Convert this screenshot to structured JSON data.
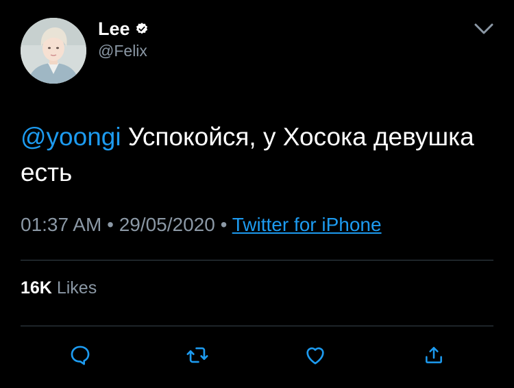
{
  "author": {
    "display_name": "Lee",
    "handle": "@Felix",
    "verified": true
  },
  "tweet": {
    "mention": "@yoongi",
    "body": " Успокойся, у Хосока девушка есть"
  },
  "meta": {
    "time": "01:37 AM",
    "separator": " • ",
    "date": "29/05/2020",
    "source": "Twitter for iPhone"
  },
  "stats": {
    "likes_count": "16K",
    "likes_label": "Likes"
  },
  "actions": [
    "reply-icon",
    "retweet-icon",
    "like-icon",
    "share-icon"
  ],
  "colors": {
    "background": "#000000",
    "link": "#1d9bf0",
    "secondary_text": "#8b98a5",
    "divider": "#38444d",
    "icon": "#1d9bf0"
  }
}
